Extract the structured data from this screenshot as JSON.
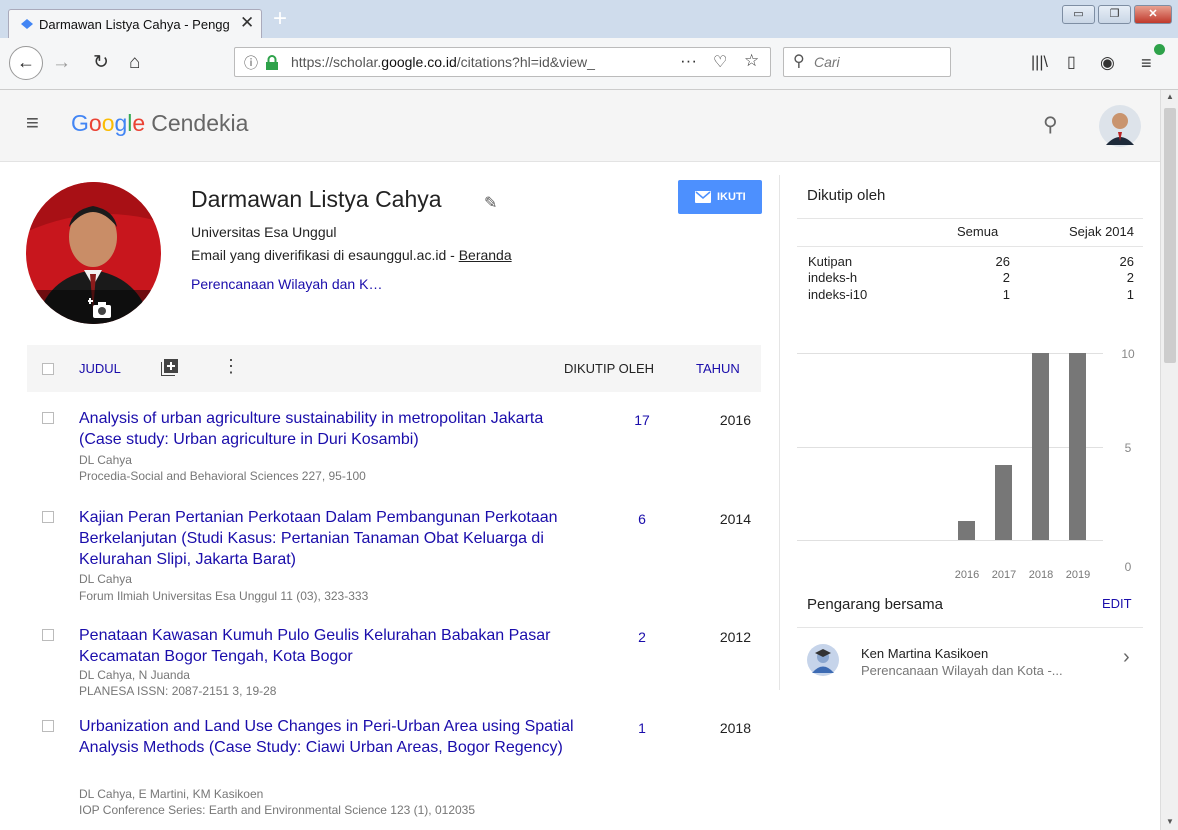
{
  "browser": {
    "tab_title": "Darmawan Listya Cahya - Pengg",
    "url_prefix": "https://scholar.",
    "url_domain": "google.co.id",
    "url_rest": "/citations?hl=id&view_",
    "search_placeholder": "Cari"
  },
  "header": {
    "logo_g": "G",
    "logo_o1": "o",
    "logo_o2": "o",
    "logo_g2": "g",
    "logo_l": "l",
    "logo_e": "e",
    "logo_suffix": "Cendekia"
  },
  "profile": {
    "name": "Darmawan Listya Cahya",
    "affiliation": "Universitas Esa Unggul",
    "email_text": "Email yang diverifikasi di esaunggul.ac.id - ",
    "homepage_link": "Beranda",
    "interests": "Perencanaan Wilayah dan K…",
    "follow_label": "IKUTI"
  },
  "table": {
    "col_title": "JUDUL",
    "col_cited": "DIKUTIP OLEH",
    "col_year": "TAHUN",
    "articles": [
      {
        "title": "Analysis of urban agriculture sustainability in metropolitan Jakarta (Case study: Urban agriculture in Duri Kosambi)",
        "authors": "DL Cahya",
        "venue": "Procedia-Social and Behavioral Sciences 227, 95-100",
        "cited": "17",
        "year": "2016"
      },
      {
        "title": "Kajian Peran Pertanian Perkotaan Dalam Pembangunan Perkotaan Berkelanjutan (Studi Kasus: Pertanian Tanaman Obat Keluarga di Kelurahan Slipi, Jakarta Barat)",
        "authors": "DL Cahya",
        "venue": "Forum Ilmiah Universitas Esa Unggul 11 (03), 323-333",
        "cited": "6",
        "year": "2014"
      },
      {
        "title": "Penataan Kawasan Kumuh Pulo Geulis Kelurahan Babakan Pasar Kecamatan Bogor Tengah, Kota Bogor",
        "authors": "DL Cahya, N Juanda",
        "venue": "PLANESA ISSN: 2087-2151 3, 19-28",
        "cited": "2",
        "year": "2012"
      },
      {
        "title": "Urbanization and Land Use Changes in Peri-Urban Area using Spatial Analysis Methods (Case Study: Ciawi Urban Areas, Bogor Regency)",
        "authors": "DL Cahya, E Martini, KM Kasikoen",
        "venue": "IOP Conference Series: Earth and Environmental Science 123 (1), 012035",
        "cited": "1",
        "year": "2018"
      }
    ]
  },
  "cited_by": {
    "heading": "Dikutip oleh",
    "col_all": "Semua",
    "col_since": "Sejak 2014",
    "rows": [
      {
        "label": "Kutipan",
        "all": "26",
        "since": "26"
      },
      {
        "label": "indeks-h",
        "all": "2",
        "since": "2"
      },
      {
        "label": "indeks-i10",
        "all": "1",
        "since": "1"
      }
    ]
  },
  "chart_data": {
    "type": "bar",
    "categories": [
      "2016",
      "2017",
      "2018",
      "2019"
    ],
    "values": [
      1,
      4,
      10,
      10
    ],
    "ylim": [
      0,
      10
    ],
    "yticks": [
      "10",
      "5",
      "0"
    ],
    "bar_color": "#777777"
  },
  "coauthors": {
    "heading": "Pengarang bersama",
    "edit_label": "EDIT",
    "items": [
      {
        "name": "Ken Martina Kasikoen",
        "affiliation": "Perencanaan Wilayah dan Kota -..."
      }
    ]
  },
  "colors": {
    "link": "#1a0dab",
    "follow_button": "#4d90fe",
    "secure_lock": "#2ea24a"
  }
}
